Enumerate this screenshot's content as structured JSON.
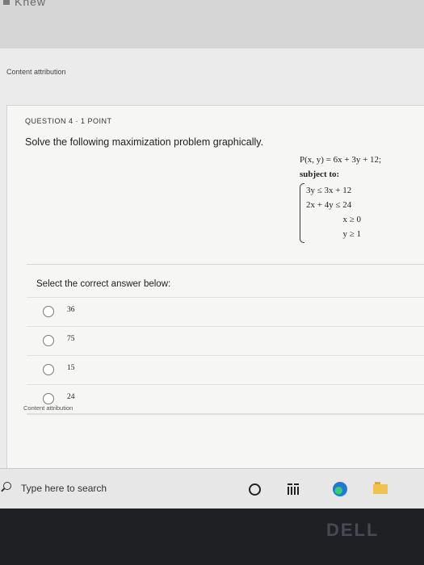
{
  "browser": {
    "brand": "Knew"
  },
  "page": {
    "attribution_top": "Content attribution"
  },
  "question": {
    "header": "QUESTION 4  ·  1 POINT",
    "prompt": "Solve the following maximization problem graphically.",
    "objective": "P(x, y) = 6x + 3y + 12;",
    "subject_to": "subject to:",
    "constraints": [
      "3y ≤ 3x + 12",
      "2x + 4y ≤ 24",
      "x ≥ 0",
      "y ≥ 1"
    ]
  },
  "answers": {
    "label": "Select the correct answer below:",
    "options": [
      "36",
      "75",
      "15",
      "24"
    ],
    "attribution": "Content attribution"
  },
  "taskbar": {
    "search_placeholder": "Type here to search"
  },
  "device": {
    "brand": "DELL"
  }
}
